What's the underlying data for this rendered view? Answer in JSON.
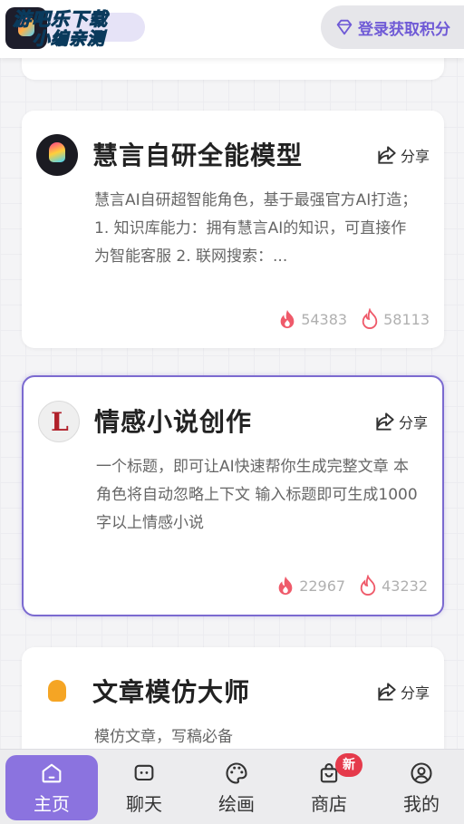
{
  "header": {
    "watermark_line1": "游吧乐下载",
    "watermark_line2": "小编亲测",
    "login_label": "登录获取积分"
  },
  "cards": [
    {
      "avatar_icon": "rainbow-lightbulb-icon",
      "title": "慧言自研全能模型",
      "share_label": "分享",
      "description": "慧言AI自研超智能角色，基于最强官方AI打造； 1. 知识库能力：拥有慧言AI的知识，可直接作为智能客服 2. 联网搜索：...",
      "hot_count": "54383",
      "like_count": "58113"
    },
    {
      "avatar_icon": "red-l-logo-icon",
      "title": "情感小说创作",
      "share_label": "分享",
      "description": "一个标题，即可让AI快速帮你生成完整文章 本角色将自动忽略上下文 输入标题即可生成1000字以上情感小说",
      "hot_count": "22967",
      "like_count": "43232"
    },
    {
      "avatar_icon": "orange-lightbulb-icon",
      "title": "文章模仿大师",
      "share_label": "分享",
      "description": "模仿文章，写稿必备"
    }
  ],
  "nav": {
    "home": "主页",
    "chat": "聊天",
    "draw": "绘画",
    "shop": "商店",
    "shop_badge": "新",
    "profile": "我的"
  },
  "colors": {
    "accent": "#8b73df",
    "hot_icon": "#ef5a6a",
    "badge": "#e53a4b"
  }
}
